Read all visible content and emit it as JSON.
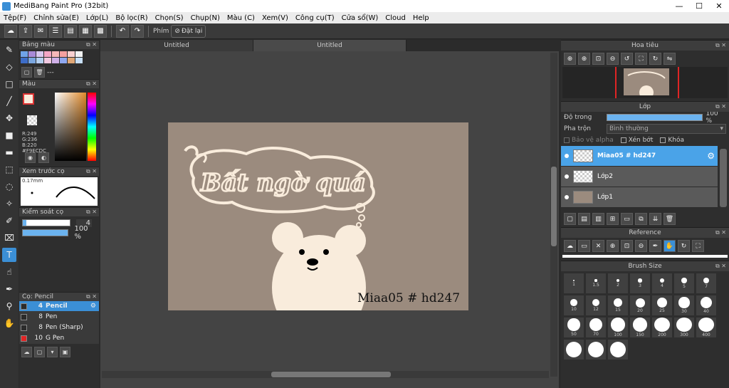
{
  "window": {
    "title": "MediBang Paint Pro (32bit)",
    "min": "—",
    "max": "☐",
    "close": "✕"
  },
  "menu": [
    "Tệp(F)",
    "Chỉnh sửa(E)",
    "Lớp(L)",
    "Bộ lọc(R)",
    "Chọn(S)",
    "Chụp(N)",
    "Màu (C)",
    "Xem(V)",
    "Công cụ(T)",
    "Cửa sổ(W)",
    "Cloud",
    "Help"
  ],
  "toolbar": {
    "shortcut_label": "Phím",
    "reset_label": "Đặt lại"
  },
  "left_panels": {
    "palette_title": "Bảng màu",
    "palette_extra": "---",
    "color_title": "Màu",
    "rgb_r": "R:249",
    "rgb_g": "G:236",
    "rgb_b": "B:220",
    "hex": "#F9ECDC",
    "preview_title": "Xem trước cọ",
    "preview_size": "0.17mm",
    "brush_control_title": "Kiểm soát cọ",
    "brush_size_value": "4",
    "brush_opacity_value": "100 %",
    "brush_opacity_fraction": 1.0,
    "brush_size_fraction": 0.07,
    "brush_title": "Cọ: Pencil",
    "brushes": [
      {
        "size": "4",
        "name": "Pencil",
        "color": "#2b2b2b",
        "selected": true
      },
      {
        "size": "8",
        "name": "Pen",
        "color": "#2b2b2b",
        "selected": false
      },
      {
        "size": "8",
        "name": "Pen (Sharp)",
        "color": "#2b2b2b",
        "selected": false
      },
      {
        "size": "10",
        "name": "G Pen",
        "color": "#e02525",
        "selected": false
      }
    ]
  },
  "tabs": [
    "Untitled",
    "Untitled"
  ],
  "artwork": {
    "title_text": "Bất ngờ quá",
    "signature": "Miaa05 # hd247"
  },
  "right_panels": {
    "navigator_title": "Hoa tiêu",
    "layers_title": "Lớp",
    "opacity_label": "Độ trong",
    "opacity_value": "100 %",
    "opacity_fraction": 1.0,
    "blend_label": "Pha trộn",
    "blend_value": "Bình thường",
    "protect_alpha": "Bảo vệ alpha",
    "clipping": "Xén bớt",
    "lock": "Khóa",
    "layers": [
      {
        "name": "Miaa05 # hd247",
        "selected": true
      },
      {
        "name": "Lớp2",
        "selected": false
      },
      {
        "name": "Lớp1",
        "selected": false
      }
    ],
    "reference_title": "Reference",
    "brush_size_title": "Brush Size",
    "brush_sizes": [
      "1",
      "1.5",
      "2",
      "3",
      "4",
      "5",
      "7",
      "10",
      "12",
      "15",
      "20",
      "25",
      "30",
      "40",
      "50",
      "70",
      "100",
      "150",
      "200",
      "300",
      "400",
      "",
      "",
      ""
    ]
  },
  "colors": {
    "accent": "#3b8fd6",
    "canvas_bg": "#9b8b7e",
    "foreground": "#F9ECDC",
    "bear": "#f9ecdc",
    "text_outline": "#f9ecdc"
  }
}
